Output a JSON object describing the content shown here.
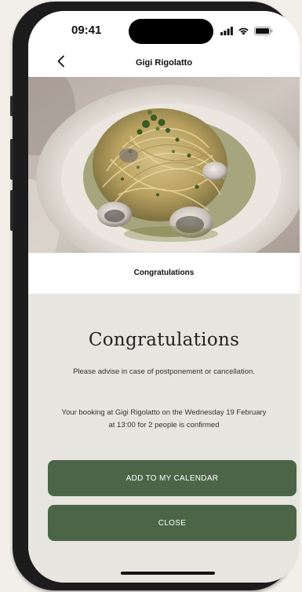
{
  "status_bar": {
    "time": "09:41",
    "icons": [
      "signal-icon",
      "wifi-icon",
      "battery-icon"
    ]
  },
  "nav": {
    "back_icon": "chevron-left-icon",
    "title": "Gigi Rigolatto"
  },
  "hero": {
    "image": "pasta with clams dish"
  },
  "subheader": {
    "title": "Congratulations"
  },
  "confirmation": {
    "heading": "Congratulations",
    "message_advice": "Please advise in case of postponement or cancellation.",
    "message_booking": "Your booking at Gigi Rigolatto on the Wednesday 19 February at 13:00 for 2 people is confirmed"
  },
  "actions": {
    "calendar_label": "ADD TO MY CALENDAR",
    "close_label": "CLOSE"
  },
  "colors": {
    "accent": "#4c6547",
    "background": "#e7e5e0",
    "frame": "#1c1c1c"
  }
}
